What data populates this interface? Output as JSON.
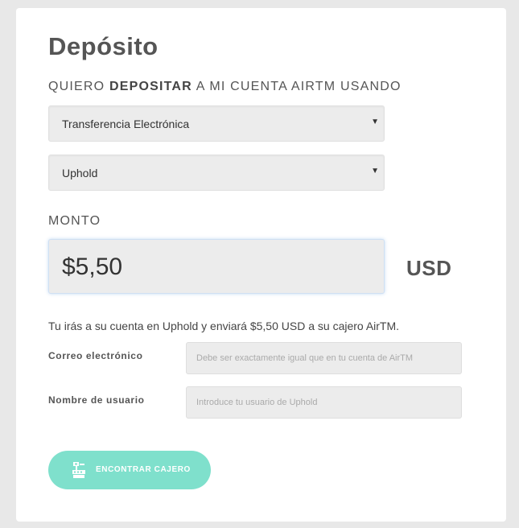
{
  "form": {
    "title": "Depósito",
    "subtitle_pre": "QUIERO ",
    "subtitle_bold": "DEPOSITAR",
    "subtitle_post": " A MI CUENTA AIRTM USANDO",
    "method_select": {
      "value": "Transferencia Electrónica"
    },
    "provider_select": {
      "value": "Uphold"
    },
    "amount_label": "MONTO",
    "amount_value": "$5,50",
    "currency": "USD",
    "info_text": "Tu irás a su cuenta en Uphold y enviará $5,50 USD a su cajero AirTM.",
    "email": {
      "label": "Correo electrónico",
      "placeholder": "Debe ser exactamente igual que en tu cuenta de AirTM"
    },
    "username": {
      "label": "Nombre de usuario",
      "placeholder": "Introduce tu usuario de Uphold"
    },
    "submit": {
      "label": "ENCONTRAR CAJERO",
      "icon": "cashier-icon"
    }
  },
  "colors": {
    "page_bg": "#e8e8e8",
    "card_bg": "#ffffff",
    "button_bg": "#7fe0cc",
    "input_bg": "#ececec",
    "text": "#555555"
  }
}
